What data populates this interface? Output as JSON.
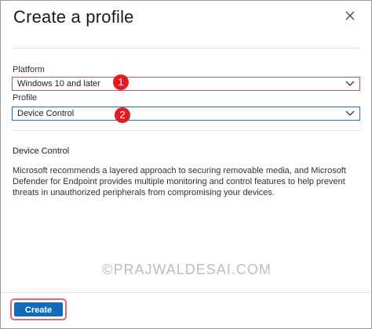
{
  "dialog": {
    "title": "Create a profile",
    "close_icon": "close-icon"
  },
  "platform": {
    "label": "Platform",
    "value": "Windows 10 and later",
    "badge": "1"
  },
  "profile": {
    "label": "Profile",
    "value": "Device Control",
    "badge": "2"
  },
  "details": {
    "title": "Device Control",
    "description": "Microsoft recommends a layered approach to securing removable media, and Microsoft Defender for Endpoint provides multiple monitoring and control features to help prevent threats in unauthorized peripherals from compromising your devices."
  },
  "watermark": "©PRAJWALDESAI.COM",
  "footer": {
    "create_label": "Create"
  },
  "colors": {
    "primary": "#0f6cbd",
    "badge": "#e31b23",
    "highlight": "#e06a6a"
  }
}
